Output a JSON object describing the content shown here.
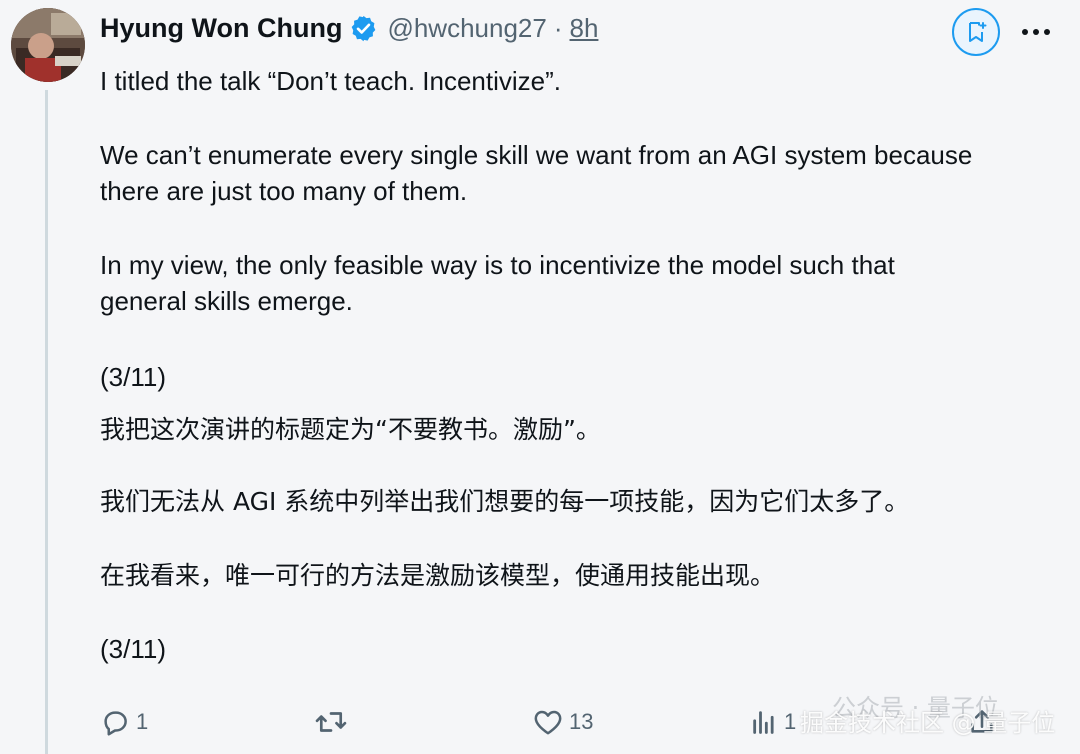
{
  "tweet": {
    "author_name": "Hyung Won Chung",
    "handle": "@hwchung27",
    "separator": "·",
    "time": "8h",
    "lines": [
      "I titled the talk “Don’t teach. Incentivize”.",
      "We can’t enumerate every single skill we want from an AGI system because",
      "there are just too many of them.",
      "In my view, the only feasible way is to incentivize the model such that",
      "general skills emerge.",
      "(3/11)",
      "我把这次演讲的标题定为“不要教书。激励”。",
      "我们无法从 AGI 系统中列举出我们想要的每一项技能，因为它们太多了。",
      "在我看来，唯一可行的方法是激励该模型，使通用技能出现。",
      "(3/11)"
    ]
  },
  "actions": {
    "reply_count": "1",
    "retweet_count": "",
    "like_count": "13",
    "views_count": "1"
  },
  "watermarks": {
    "faint": "公众号 · 量子位",
    "main": "掘金技术社区 @ 量子位"
  },
  "colors": {
    "accent": "#1d9bf0",
    "muted": "#536471",
    "text": "#0f1419",
    "background": "#f5f6f8"
  },
  "icons": [
    "verified-badge-icon",
    "grok-icon",
    "more-icon",
    "reply-icon",
    "retweet-icon",
    "like-icon",
    "views-icon"
  ]
}
